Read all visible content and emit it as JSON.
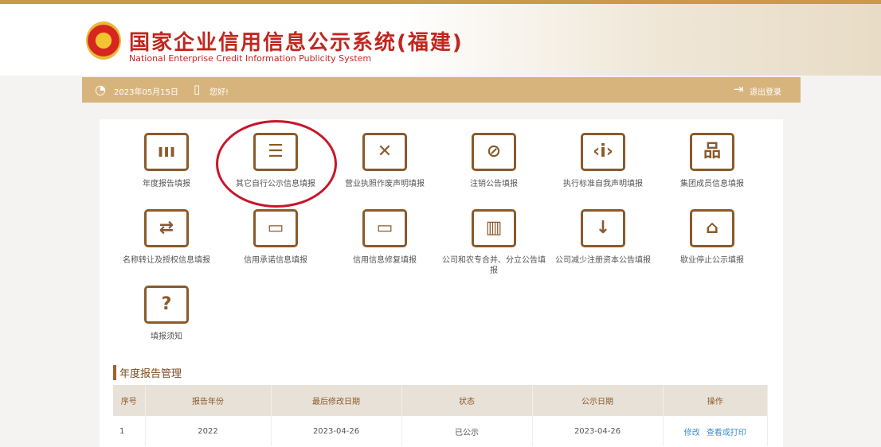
{
  "header": {
    "title_cn": "国家企业信用信息公示系统(福建)",
    "title_en": "National Enterprise Credit Information Publicity System"
  },
  "bar": {
    "date": "2023年05月15日",
    "greeting": "您好!",
    "logout": "退出登录"
  },
  "tiles": [
    {
      "label": "年度报告填报",
      "icon": "calendar-icon"
    },
    {
      "label": "其它自行公示信息填报",
      "icon": "notice-board-icon"
    },
    {
      "label": "营业执照作废声明填报",
      "icon": "document-x-icon"
    },
    {
      "label": "注销公告填报",
      "icon": "cancel-doc-icon"
    },
    {
      "label": "执行标准自我声明填报",
      "icon": "clipboard-code-icon"
    },
    {
      "label": "集团成员信息填报",
      "icon": "org-chart-icon"
    },
    {
      "label": "名称转让及授权信息填报",
      "icon": "transfer-receipt-icon"
    },
    {
      "label": "信用承诺信息填报",
      "icon": "card-icon"
    },
    {
      "label": "信用信息修复填报",
      "icon": "card-icon"
    },
    {
      "label": "公司和农专合并、分立公告填报",
      "icon": "buildings-icon"
    },
    {
      "label": "公司减少注册资本公告填报",
      "icon": "money-bag-icon"
    },
    {
      "label": "歇业停止公示填报",
      "icon": "store-icon"
    },
    {
      "label": "填报须知",
      "icon": "question-edit-icon"
    }
  ],
  "section_title": "年度报告管理",
  "table": {
    "headers": [
      "序号",
      "报告年份",
      "最后修改日期",
      "状态",
      "公示日期",
      "操作"
    ],
    "rows": [
      {
        "no": "1",
        "year": "2022",
        "modified": "2023-04-26",
        "status": "已公示",
        "published": "2023-04-26",
        "actions": [
          "修改",
          "查看或打印"
        ]
      }
    ]
  },
  "colors": {
    "accent": "#d8b47d",
    "icon": "#8a5a2b",
    "highlight_circle": "#c8162a"
  }
}
